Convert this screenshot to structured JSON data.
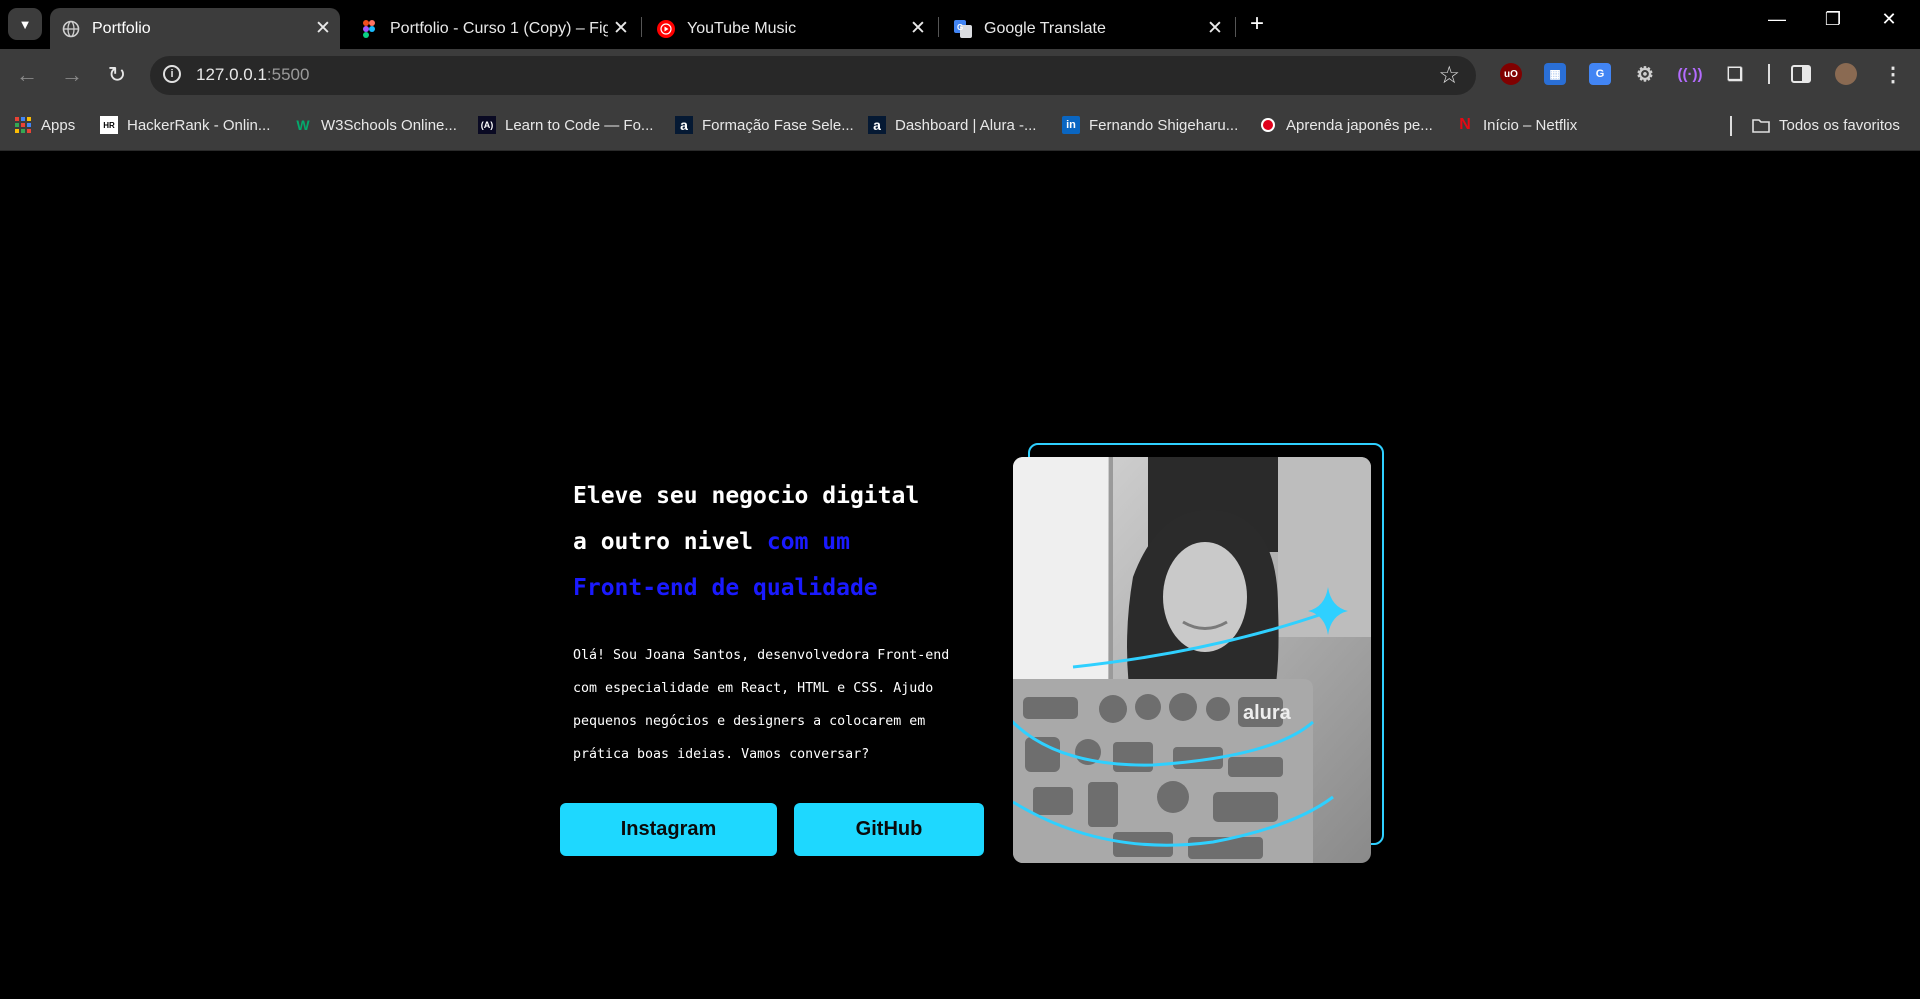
{
  "browser": {
    "tabs": [
      {
        "title": "Portfolio",
        "active": true,
        "favicon": "globe-icon"
      },
      {
        "title": "Portfolio - Curso 1 (Copy) – Figma",
        "active": false,
        "favicon": "figma-icon"
      },
      {
        "title": "YouTube Music",
        "active": false,
        "favicon": "youtube-music-icon"
      },
      {
        "title": "Google Translate",
        "active": false,
        "favicon": "google-translate-icon"
      }
    ],
    "address": {
      "host": "127.0.0.1",
      "port": ":5500"
    },
    "bookmarks": [
      {
        "label": "Apps",
        "icon": "apps-grid-icon"
      },
      {
        "label": "HackerRank - Onlin...",
        "icon": "hackerrank-icon"
      },
      {
        "label": "W3Schools Online...",
        "icon": "w3schools-icon"
      },
      {
        "label": "Learn to Code — Fo...",
        "icon": "freecodecamp-icon"
      },
      {
        "label": "Formação Fase Sele...",
        "icon": "alura-icon"
      },
      {
        "label": "Dashboard | Alura -...",
        "icon": "alura-icon"
      },
      {
        "label": "Fernando Shigeharu...",
        "icon": "linkedin-icon"
      },
      {
        "label": "Aprenda japonês pe...",
        "icon": "record-icon"
      },
      {
        "label": "Início – Netflix",
        "icon": "netflix-icon"
      }
    ],
    "all_bookmarks": "Todos os favoritos"
  },
  "hero": {
    "line1": "Eleve seu negocio digital",
    "line2_plain": "a outro nivel ",
    "line2_highlight": "com um",
    "line3_highlight": "Front-end de qualidade",
    "intro_lines": [
      "Olá! Sou Joana Santos, desenvolvedora Front-end",
      "com especialidade em React, HTML e CSS. Ajudo",
      "pequenos negócios e designers a colocarem em",
      "prática boas ideias. Vamos conversar?"
    ],
    "buttons": {
      "instagram": "Instagram",
      "github": "GitHub"
    },
    "photo_laptop_text": "alura"
  },
  "colors": {
    "accent": "#1ed8ff",
    "highlight": "#1a1aff",
    "frame": "#2fd0ff",
    "background": "#000000"
  }
}
